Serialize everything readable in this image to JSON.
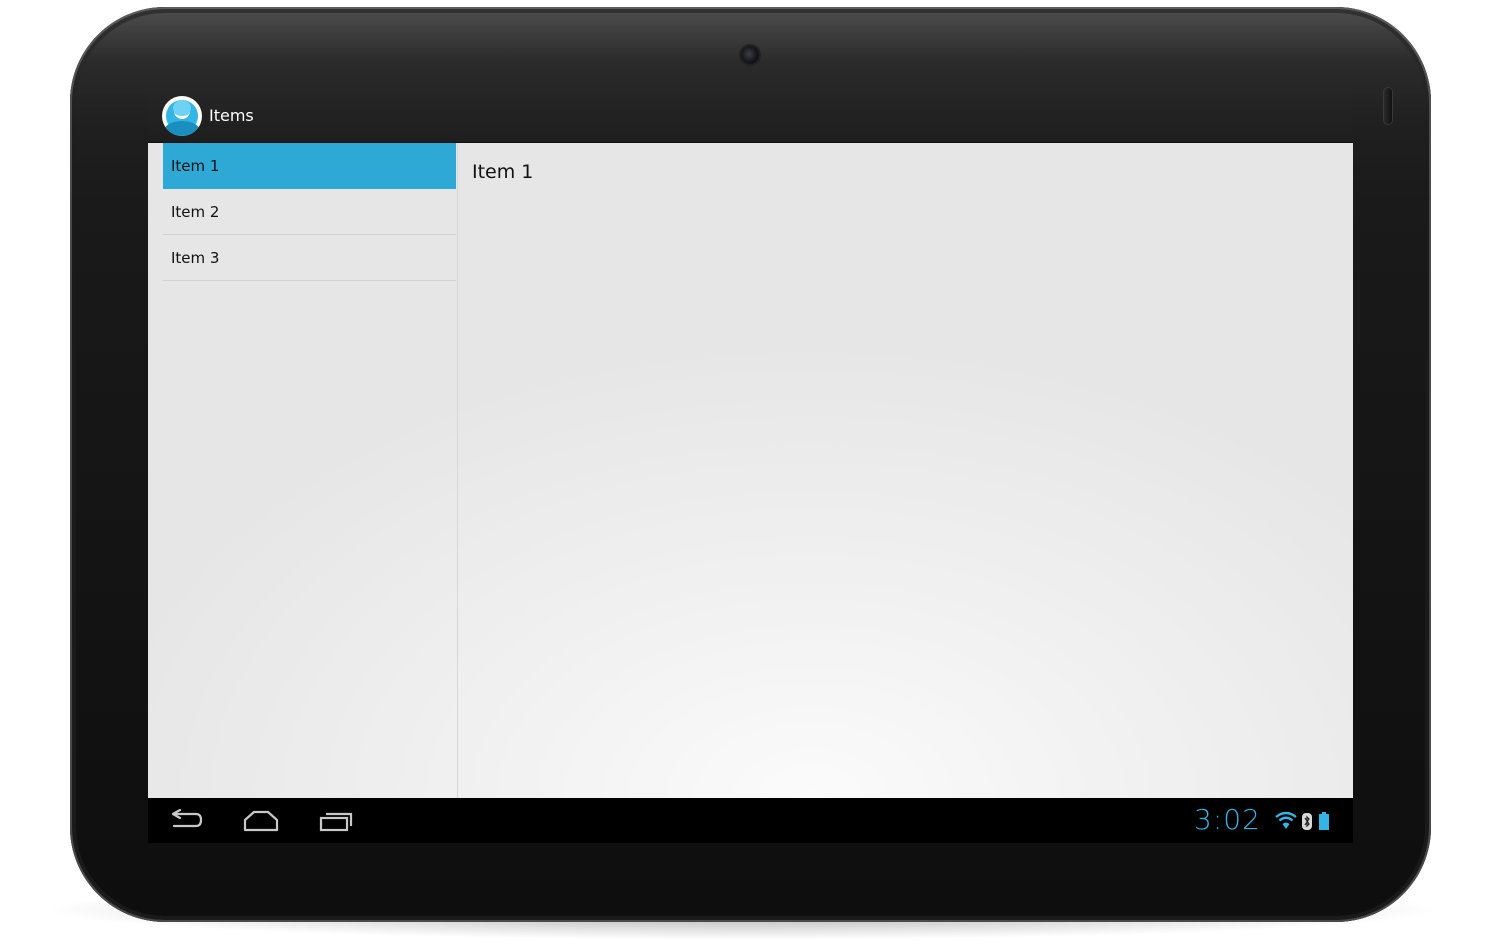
{
  "action_bar": {
    "title": "Items",
    "app_icon": "app-logo-icon"
  },
  "list": {
    "items": [
      {
        "label": "Item 1",
        "selected": true
      },
      {
        "label": "Item 2",
        "selected": false
      },
      {
        "label": "Item 3",
        "selected": false
      }
    ]
  },
  "detail": {
    "text": "Item 1"
  },
  "nav_bar": {
    "back_icon": "back-icon",
    "home_icon": "home-icon",
    "recents_icon": "recent-apps-icon"
  },
  "status": {
    "time": "3:02",
    "icons": [
      "wifi-icon",
      "bluetooth-icon",
      "battery-icon"
    ]
  },
  "colors": {
    "accent": "#33b5e5",
    "selected_row": "#2ea8d5",
    "action_bar": "#222222",
    "nav_bar": "#000000"
  }
}
